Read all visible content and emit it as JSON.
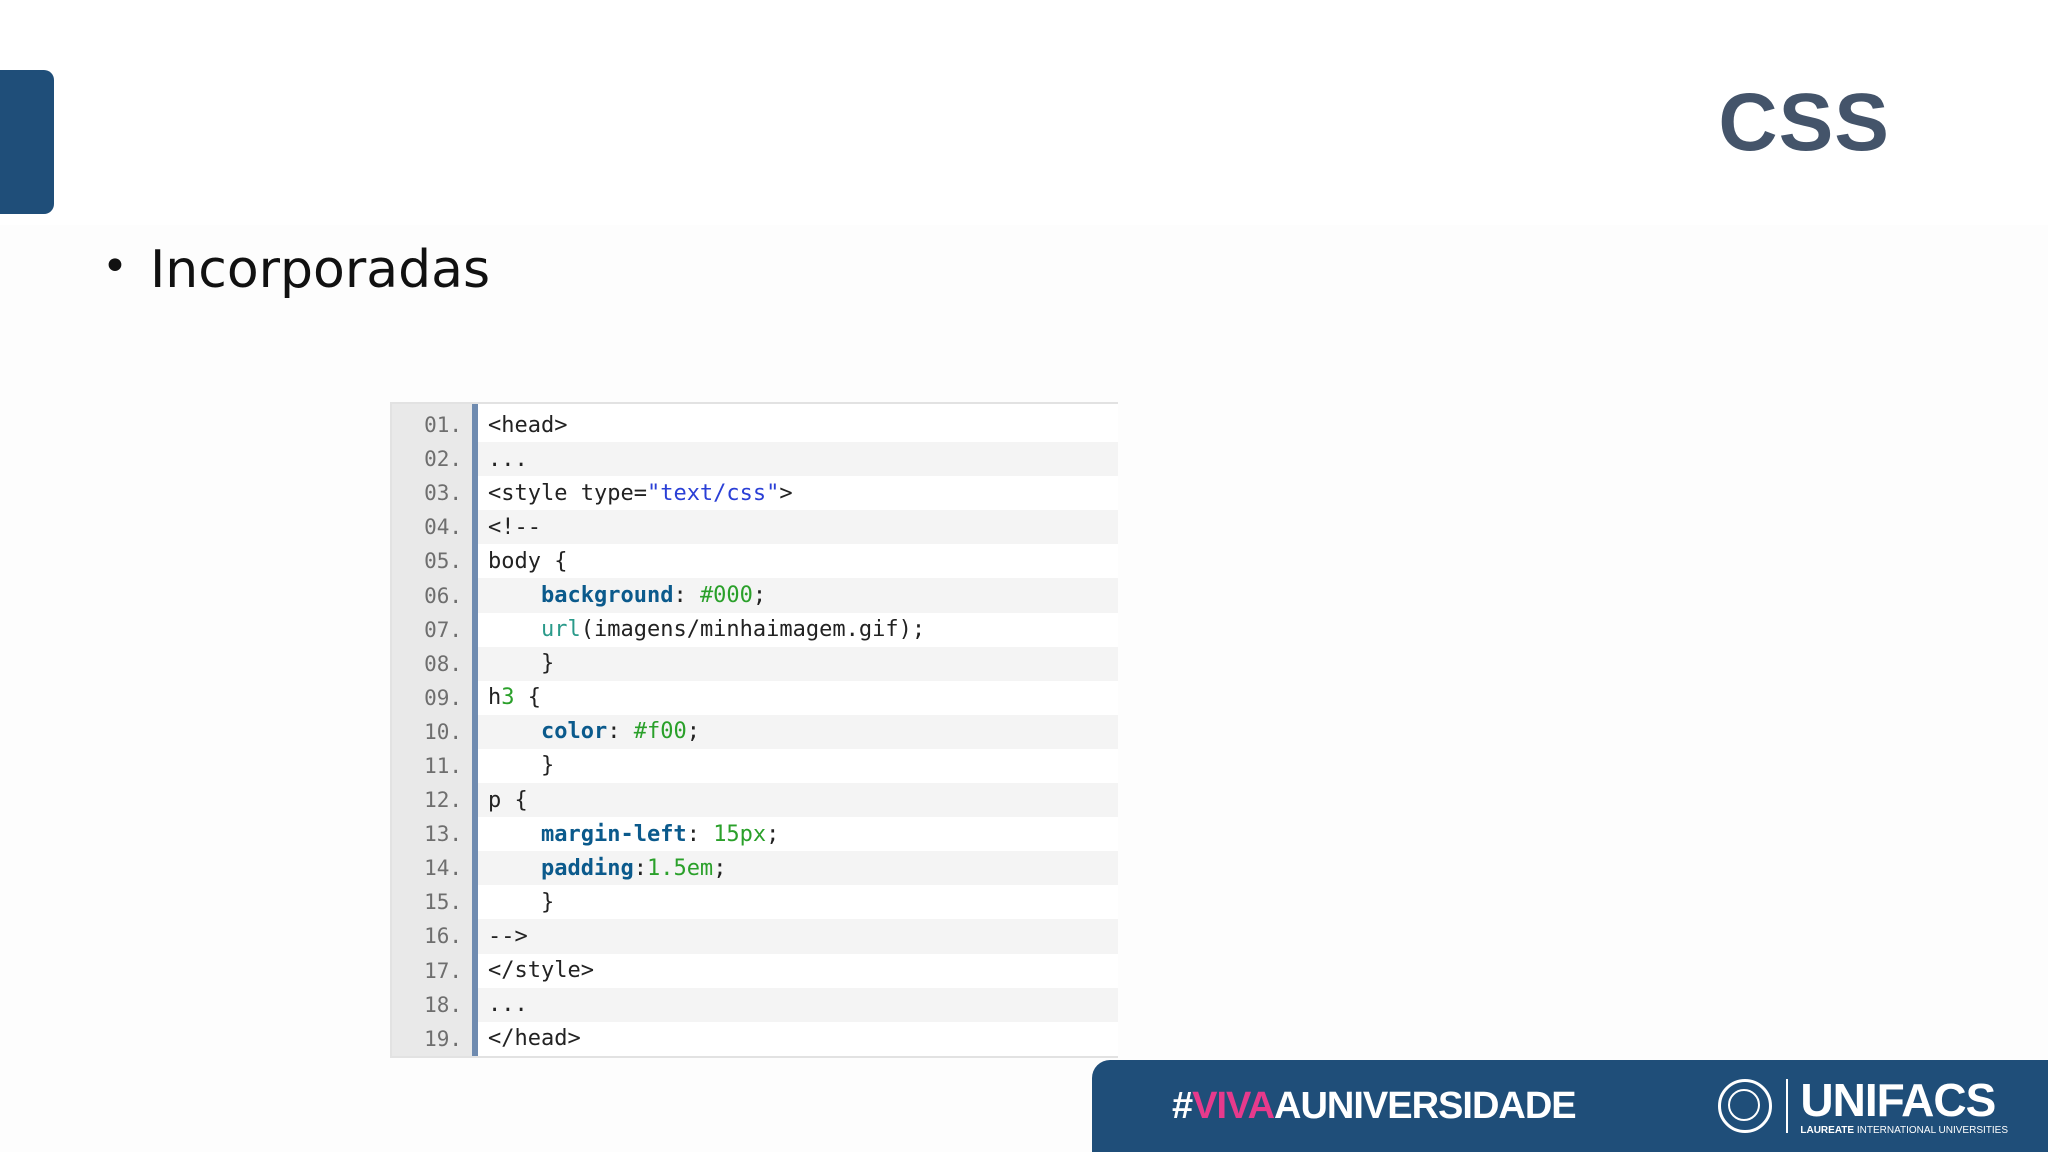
{
  "slide": {
    "title": "CSS",
    "bullet": "Incorporadas"
  },
  "code": {
    "lines": [
      {
        "num": "01.",
        "tokens": [
          {
            "t": "<head>",
            "c": ""
          }
        ]
      },
      {
        "num": "02.",
        "tokens": [
          {
            "t": "...",
            "c": ""
          }
        ]
      },
      {
        "num": "03.",
        "tokens": [
          {
            "t": "<style type=",
            "c": ""
          },
          {
            "t": "\"text/css\"",
            "c": "str"
          },
          {
            "t": ">",
            "c": ""
          }
        ]
      },
      {
        "num": "04.",
        "tokens": [
          {
            "t": "<!--",
            "c": ""
          }
        ]
      },
      {
        "num": "05.",
        "tokens": [
          {
            "t": "body {",
            "c": ""
          }
        ]
      },
      {
        "num": "06.",
        "tokens": [
          {
            "t": "    ",
            "c": ""
          },
          {
            "t": "background",
            "c": "prop"
          },
          {
            "t": ": ",
            "c": ""
          },
          {
            "t": "#000",
            "c": "val"
          },
          {
            "t": ";",
            "c": ""
          }
        ]
      },
      {
        "num": "07.",
        "tokens": [
          {
            "t": "    ",
            "c": ""
          },
          {
            "t": "url",
            "c": "fn"
          },
          {
            "t": "(imagens/minhaimagem.gif);",
            "c": ""
          }
        ]
      },
      {
        "num": "08.",
        "tokens": [
          {
            "t": "    }",
            "c": ""
          }
        ]
      },
      {
        "num": "09.",
        "tokens": [
          {
            "t": "h",
            "c": ""
          },
          {
            "t": "3",
            "c": "val"
          },
          {
            "t": " {",
            "c": ""
          }
        ]
      },
      {
        "num": "10.",
        "tokens": [
          {
            "t": "    ",
            "c": ""
          },
          {
            "t": "color",
            "c": "prop"
          },
          {
            "t": ": ",
            "c": ""
          },
          {
            "t": "#f00",
            "c": "val"
          },
          {
            "t": ";",
            "c": ""
          }
        ]
      },
      {
        "num": "11.",
        "tokens": [
          {
            "t": "    }",
            "c": ""
          }
        ]
      },
      {
        "num": "12.",
        "tokens": [
          {
            "t": "p {",
            "c": ""
          }
        ]
      },
      {
        "num": "13.",
        "tokens": [
          {
            "t": "    ",
            "c": ""
          },
          {
            "t": "margin-left",
            "c": "prop"
          },
          {
            "t": ": ",
            "c": ""
          },
          {
            "t": "15px",
            "c": "val"
          },
          {
            "t": ";",
            "c": ""
          }
        ]
      },
      {
        "num": "14.",
        "tokens": [
          {
            "t": "    ",
            "c": ""
          },
          {
            "t": "padding",
            "c": "prop"
          },
          {
            "t": ":",
            "c": ""
          },
          {
            "t": "1.5em",
            "c": "val"
          },
          {
            "t": ";",
            "c": ""
          }
        ]
      },
      {
        "num": "15.",
        "tokens": [
          {
            "t": "    }",
            "c": ""
          }
        ]
      },
      {
        "num": "16.",
        "tokens": [
          {
            "t": "-->",
            "c": ""
          }
        ]
      },
      {
        "num": "17.",
        "tokens": [
          {
            "t": "</style>",
            "c": ""
          }
        ]
      },
      {
        "num": "18.",
        "tokens": [
          {
            "t": "...",
            "c": ""
          }
        ]
      },
      {
        "num": "19.",
        "tokens": [
          {
            "t": "</head>",
            "c": ""
          }
        ]
      }
    ]
  },
  "footer": {
    "hash": "#",
    "viva": "VIVA",
    "universidade": "AUNIVERSIDADE",
    "logo_name": "UNIFACS",
    "logo_sub_bold": "LAUREATE",
    "logo_sub_rest": " INTERNATIONAL UNIVERSITIES"
  },
  "colors": {
    "accent": "#1f4e79",
    "title": "#44546a",
    "viva_pink": "#e63a8c"
  },
  "icons": {
    "seal": "university-seal-icon"
  }
}
